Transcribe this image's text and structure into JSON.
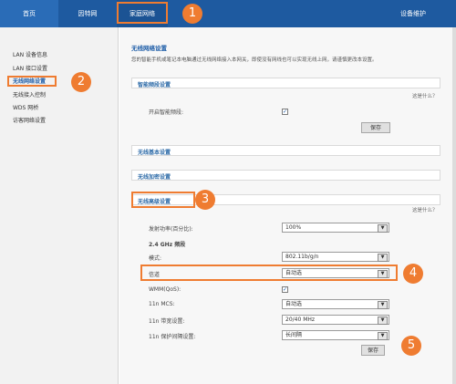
{
  "nav": {
    "tabs": [
      {
        "label": "首页"
      },
      {
        "label": "因特网"
      },
      {
        "label": "家庭网络"
      },
      {
        "label": "设备维护"
      }
    ]
  },
  "badges": [
    "1",
    "2",
    "3",
    "4",
    "5"
  ],
  "sidebar": {
    "items": [
      {
        "label": "LAN 设备信息"
      },
      {
        "label": "LAN 接口设置"
      },
      {
        "label": "无线网络设置"
      },
      {
        "label": "无线接入控制"
      },
      {
        "label": "WDS 网桥"
      },
      {
        "label": "访客网络设置"
      }
    ]
  },
  "main": {
    "title": "无线网络设置",
    "desc": "您的智能手机或笔记本电脑通过无线网络接入本网关，即使没有网线也可以实现无线上网，请谨慎更改本设置。",
    "help": "这是什么？",
    "smart": {
      "header": "智能频段设置",
      "enable_label": "开启智能频段:",
      "save": "保存"
    },
    "basic": {
      "header": "无线基本设置"
    },
    "encrypt": {
      "header": "无线加密设置"
    },
    "advanced": {
      "header": "无线高级设置",
      "power_label": "发射功率(百分比):",
      "power_value": "100%",
      "band_heading": "2.4 GHz 频段",
      "mode_label": "模式:",
      "mode_value": "802.11b/g/n",
      "channel_label": "信道",
      "channel_value": "自动选",
      "wmm_label": "WMM(QoS):",
      "mcs_label": "11n MCS:",
      "mcs_value": "自动选",
      "bw_label": "11n 带宽设置:",
      "bw_value": "20/40 MHz",
      "gi_label": "11n 保护间隔设置:",
      "gi_value": "长间隔"
    }
  },
  "colors": {
    "nav_bg": "#1e5aa0",
    "accent": "#ef7c31",
    "title_blue": "#1f5ea8"
  }
}
